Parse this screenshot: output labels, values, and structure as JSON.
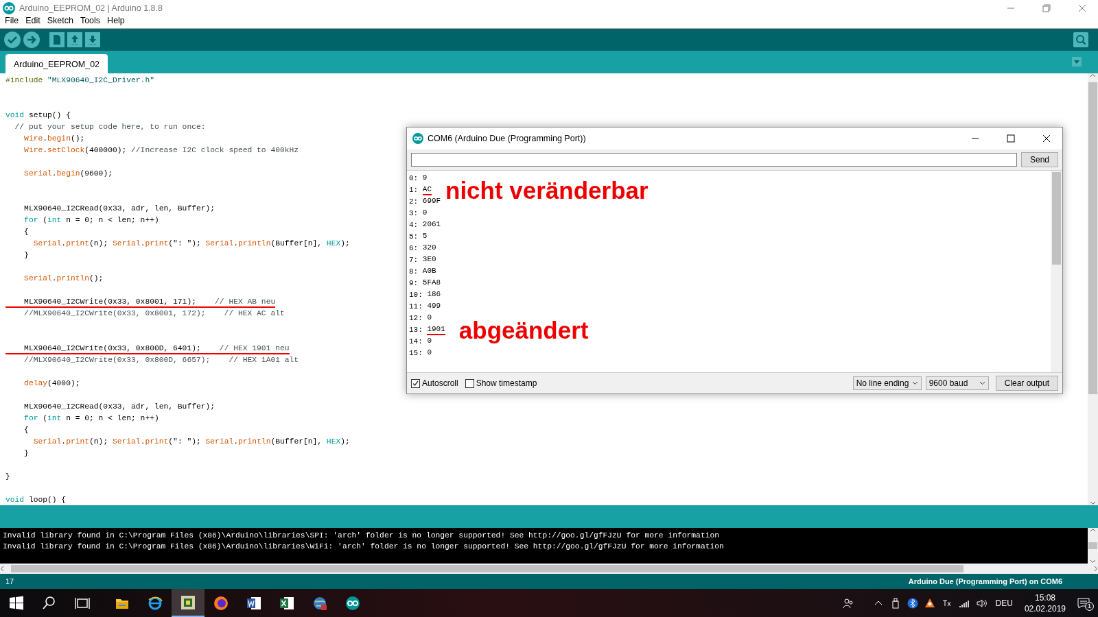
{
  "window": {
    "title": "Arduino_EEPROM_02 | Arduino 1.8.8"
  },
  "menu": [
    "File",
    "Edit",
    "Sketch",
    "Tools",
    "Help"
  ],
  "tabs": [
    {
      "label": "Arduino_EEPROM_02",
      "selected": true
    }
  ],
  "code": {
    "lines": [
      {
        "kind": "code",
        "underlined": false,
        "segments": [
          {
            "kind": "preprocessor",
            "text": "#include"
          },
          {
            "kind": "string",
            "text": " \"MLX90640_I2C_Driver.h\""
          }
        ]
      },
      {
        "kind": "blank"
      },
      {
        "kind": "blank"
      },
      {
        "kind": "code",
        "underlined": false,
        "segments": [
          {
            "kind": "keyword",
            "text": "void"
          },
          {
            "kind": "plain",
            "text": " setup() {"
          }
        ]
      },
      {
        "kind": "code",
        "underlined": false,
        "segments": [
          {
            "kind": "comment",
            "text": "  // put your setup code here, to run once:"
          }
        ]
      },
      {
        "kind": "code",
        "underlined": false,
        "segments": [
          {
            "kind": "function",
            "text": "    Wire"
          },
          {
            "kind": "plain",
            "text": "."
          },
          {
            "kind": "function",
            "text": "begin"
          },
          {
            "kind": "plain",
            "text": "();"
          }
        ]
      },
      {
        "kind": "code",
        "underlined": false,
        "segments": [
          {
            "kind": "function",
            "text": "    Wire"
          },
          {
            "kind": "plain",
            "text": "."
          },
          {
            "kind": "function",
            "text": "setClock"
          },
          {
            "kind": "plain",
            "text": "(400000); "
          },
          {
            "kind": "comment",
            "text": "//Increase I2C clock speed to 400kHz"
          }
        ]
      },
      {
        "kind": "blank"
      },
      {
        "kind": "code",
        "underlined": false,
        "segments": [
          {
            "kind": "function",
            "text": "    Serial"
          },
          {
            "kind": "plain",
            "text": "."
          },
          {
            "kind": "function",
            "text": "begin"
          },
          {
            "kind": "plain",
            "text": "(9600);"
          }
        ]
      },
      {
        "kind": "blank"
      },
      {
        "kind": "blank"
      },
      {
        "kind": "code",
        "underlined": false,
        "segments": [
          {
            "kind": "plain",
            "text": "    MLX90640_I2CRead(0x33, adr, len, Buffer);"
          }
        ]
      },
      {
        "kind": "code",
        "underlined": false,
        "segments": [
          {
            "kind": "keyword",
            "text": "    for"
          },
          {
            "kind": "plain",
            "text": " ("
          },
          {
            "kind": "keyword",
            "text": "int"
          },
          {
            "kind": "plain",
            "text": " n = 0; n < len; n++)"
          }
        ]
      },
      {
        "kind": "code",
        "underlined": false,
        "segments": [
          {
            "kind": "plain",
            "text": "    {"
          }
        ]
      },
      {
        "kind": "code",
        "underlined": false,
        "segments": [
          {
            "kind": "function",
            "text": "      Serial"
          },
          {
            "kind": "plain",
            "text": "."
          },
          {
            "kind": "function",
            "text": "print"
          },
          {
            "kind": "plain",
            "text": "(n); "
          },
          {
            "kind": "function",
            "text": "Serial"
          },
          {
            "kind": "plain",
            "text": "."
          },
          {
            "kind": "function",
            "text": "print"
          },
          {
            "kind": "plain",
            "text": "(\": \"); "
          },
          {
            "kind": "function",
            "text": "Serial"
          },
          {
            "kind": "plain",
            "text": "."
          },
          {
            "kind": "function",
            "text": "println"
          },
          {
            "kind": "plain",
            "text": "(Buffer[n], "
          },
          {
            "kind": "keyword",
            "text": "HEX"
          },
          {
            "kind": "plain",
            "text": ");"
          }
        ]
      },
      {
        "kind": "code",
        "underlined": false,
        "segments": [
          {
            "kind": "plain",
            "text": "    }"
          }
        ]
      },
      {
        "kind": "blank"
      },
      {
        "kind": "code",
        "underlined": false,
        "segments": [
          {
            "kind": "function",
            "text": "    Serial"
          },
          {
            "kind": "plain",
            "text": "."
          },
          {
            "kind": "function",
            "text": "println"
          },
          {
            "kind": "plain",
            "text": "();"
          }
        ]
      },
      {
        "kind": "blank"
      },
      {
        "kind": "code",
        "underlined": true,
        "segments": [
          {
            "kind": "plain",
            "text": "    MLX90640_I2CWrite(0x33, 0x8001, 171);    "
          },
          {
            "kind": "comment",
            "text": "// HEX AB neu"
          }
        ]
      },
      {
        "kind": "code",
        "underlined": false,
        "segments": [
          {
            "kind": "comment",
            "text": "    //MLX90640_I2CWrite(0x33, 0x8001, 172);    // HEX AC alt"
          }
        ]
      },
      {
        "kind": "blank"
      },
      {
        "kind": "blank"
      },
      {
        "kind": "code",
        "underlined": true,
        "segments": [
          {
            "kind": "plain",
            "text": "    MLX90640_I2CWrite(0x33, 0x800D, 6401);    "
          },
          {
            "kind": "comment",
            "text": "// HEX 1901 neu"
          }
        ]
      },
      {
        "kind": "code",
        "underlined": false,
        "segments": [
          {
            "kind": "comment",
            "text": "    //MLX90640_I2CWrite(0x33, 0x800D, 6657);    // HEX 1A01 alt"
          }
        ]
      },
      {
        "kind": "blank"
      },
      {
        "kind": "code",
        "underlined": false,
        "segments": [
          {
            "kind": "function",
            "text": "    delay"
          },
          {
            "kind": "plain",
            "text": "(4000);"
          }
        ]
      },
      {
        "kind": "blank"
      },
      {
        "kind": "code",
        "underlined": false,
        "segments": [
          {
            "kind": "plain",
            "text": "    MLX90640_I2CRead(0x33, adr, len, Buffer);"
          }
        ]
      },
      {
        "kind": "code",
        "underlined": false,
        "segments": [
          {
            "kind": "keyword",
            "text": "    for"
          },
          {
            "kind": "plain",
            "text": " ("
          },
          {
            "kind": "keyword",
            "text": "int"
          },
          {
            "kind": "plain",
            "text": " n = 0; n < len; n++)"
          }
        ]
      },
      {
        "kind": "code",
        "underlined": false,
        "segments": [
          {
            "kind": "plain",
            "text": "    {"
          }
        ]
      },
      {
        "kind": "code",
        "underlined": false,
        "segments": [
          {
            "kind": "function",
            "text": "      Serial"
          },
          {
            "kind": "plain",
            "text": "."
          },
          {
            "kind": "function",
            "text": "print"
          },
          {
            "kind": "plain",
            "text": "(n); "
          },
          {
            "kind": "function",
            "text": "Serial"
          },
          {
            "kind": "plain",
            "text": "."
          },
          {
            "kind": "function",
            "text": "print"
          },
          {
            "kind": "plain",
            "text": "(\": \"); "
          },
          {
            "kind": "function",
            "text": "Serial"
          },
          {
            "kind": "plain",
            "text": "."
          },
          {
            "kind": "function",
            "text": "println"
          },
          {
            "kind": "plain",
            "text": "(Buffer[n], "
          },
          {
            "kind": "keyword",
            "text": "HEX"
          },
          {
            "kind": "plain",
            "text": ");"
          }
        ]
      },
      {
        "kind": "code",
        "underlined": false,
        "segments": [
          {
            "kind": "plain",
            "text": "    }"
          }
        ]
      },
      {
        "kind": "blank"
      },
      {
        "kind": "code",
        "underlined": false,
        "segments": [
          {
            "kind": "plain",
            "text": "}"
          }
        ]
      },
      {
        "kind": "blank"
      },
      {
        "kind": "code",
        "underlined": false,
        "segments": [
          {
            "kind": "keyword",
            "text": "void"
          },
          {
            "kind": "plain",
            "text": " loop() {"
          }
        ]
      }
    ]
  },
  "console": {
    "lines": [
      "Invalid library found in C:\\Program Files (x86)\\Arduino\\libraries\\SPI: 'arch' folder is no longer supported! See http://goo.gl/gfFJzU for more information",
      "Invalid library found in C:\\Program Files (x86)\\Arduino\\libraries\\WiFi: 'arch' folder is no longer supported! See http://goo.gl/gfFJzU for more information"
    ]
  },
  "status_bar": {
    "line": "17",
    "board": "Arduino Due (Programming Port) on COM6"
  },
  "serial_monitor": {
    "title": "COM6 (Arduino Due (Programming Port))",
    "send_button": "Send",
    "output": [
      {
        "index": "0: ",
        "value": "9",
        "underlined": false
      },
      {
        "index": "1: ",
        "value": "AC",
        "underlined": true,
        "annotation": "nicht veränderbar"
      },
      {
        "index": "2: ",
        "value": "699F",
        "underlined": false
      },
      {
        "index": "3: ",
        "value": "0",
        "underlined": false
      },
      {
        "index": "4: ",
        "value": "2061",
        "underlined": false
      },
      {
        "index": "5: ",
        "value": "5",
        "underlined": false
      },
      {
        "index": "6: ",
        "value": "320",
        "underlined": false
      },
      {
        "index": "7: ",
        "value": "3E0",
        "underlined": false
      },
      {
        "index": "8: ",
        "value": "A0B",
        "underlined": false
      },
      {
        "index": "9: ",
        "value": "5FA8",
        "underlined": false
      },
      {
        "index": "10: ",
        "value": "186",
        "underlined": false
      },
      {
        "index": "11: ",
        "value": "499",
        "underlined": false
      },
      {
        "index": "12: ",
        "value": "0",
        "underlined": false
      },
      {
        "index": "13: ",
        "value": "1901",
        "underlined": true,
        "annotation": "abgeändert"
      },
      {
        "index": "14: ",
        "value": "0",
        "underlined": false
      },
      {
        "index": "15: ",
        "value": "0",
        "underlined": false
      }
    ],
    "checkboxes": [
      {
        "label": "Autoscroll",
        "checked": true
      },
      {
        "label": "Show timestamp",
        "checked": false
      }
    ],
    "line_ending": "No line ending",
    "baud": "9600 baud",
    "clear_button": "Clear output"
  },
  "taskbar": {
    "apps": [
      {
        "kind": "explorer",
        "selected": false
      },
      {
        "kind": "browser",
        "selected": false
      },
      {
        "kind": "app",
        "selected": true
      },
      {
        "kind": "firefox",
        "selected": false
      },
      {
        "kind": "word",
        "selected": false
      },
      {
        "kind": "excel",
        "selected": false
      },
      {
        "kind": "globe",
        "selected": false
      },
      {
        "kind": "arduino",
        "selected": false
      }
    ],
    "language": "DEU",
    "time": "15:08",
    "date": "02.02.2019",
    "notifications": "1"
  }
}
